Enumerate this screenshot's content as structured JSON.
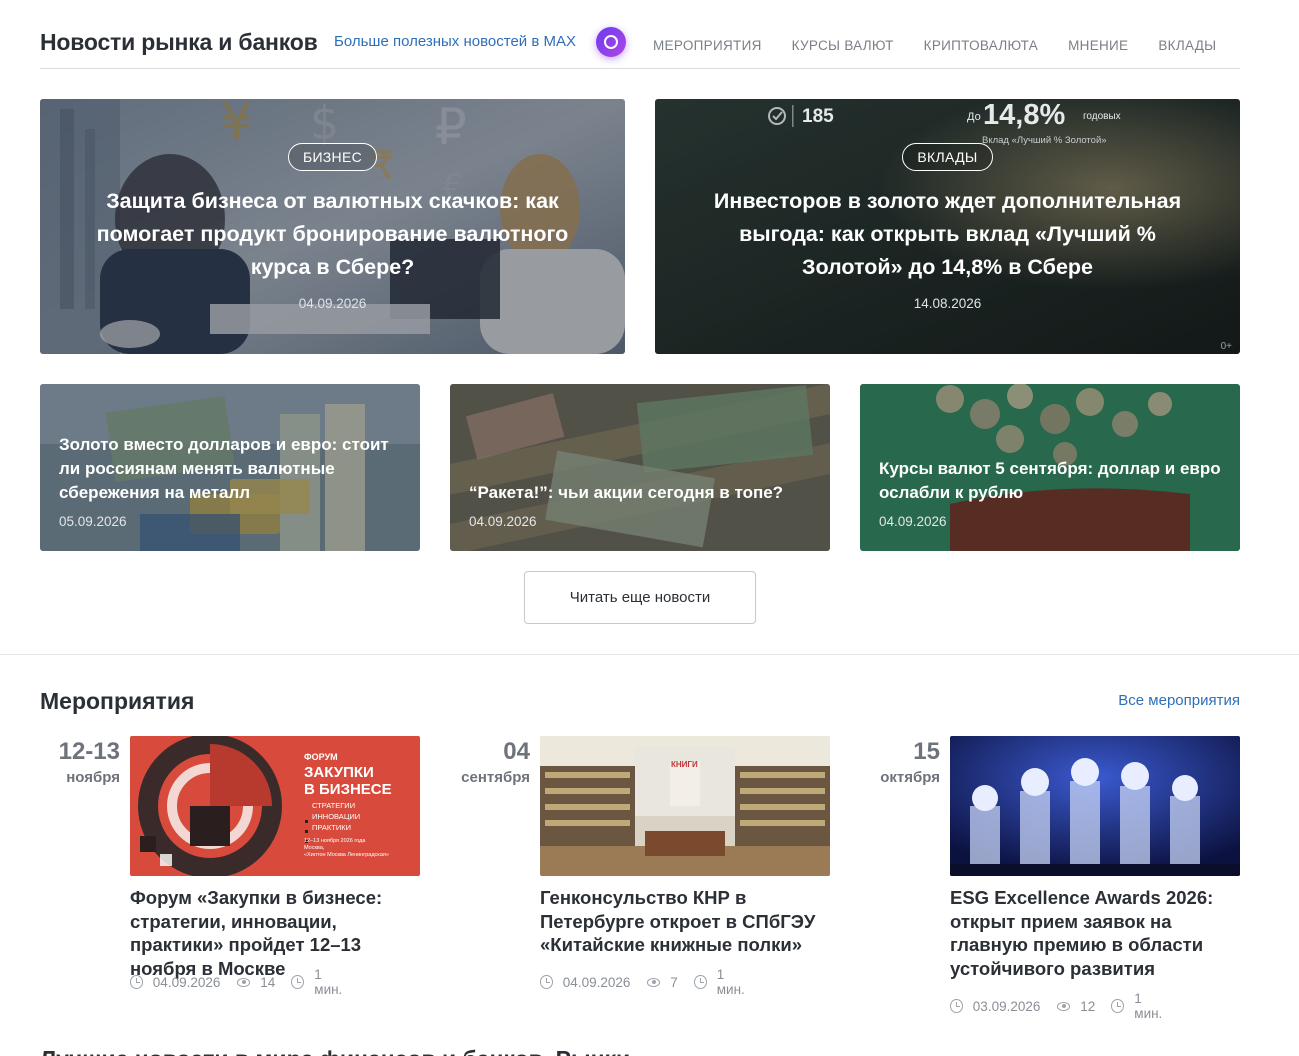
{
  "header": {
    "title": "Новости рынка и банков",
    "max_link": "Больше полезных новостей в MAX",
    "nav": [
      "МЕРОПРИЯТИЯ",
      "КУРСЫ ВАЛЮТ",
      "КРИПТОВАЛЮТА",
      "МНЕНИЕ",
      "ВКЛАДЫ"
    ]
  },
  "big_cards": [
    {
      "tag": "БИЗНЕС",
      "title": "Защита бизнеса от валютных скачков: как помогает продукт бронирование валютного курса в Сбере?",
      "date": "04.09.2026"
    },
    {
      "tag": "ВКЛАДЫ",
      "title": "Инвесторов в золото ждет дополнительная выгода: как открыть вклад «Лучший % Золотой» до 14,8% в Сбере",
      "date": "14.08.2026",
      "promo_number": "185",
      "promo_prefix": "До",
      "promo_rate": "14,8%",
      "promo_suffix": "годовых",
      "promo_caption": "Вклад «Лучший % Золотой»",
      "age": "0+"
    }
  ],
  "small_cards": [
    {
      "title": "Золото вместо долларов и евро: стоит ли россиянам менять валютные сбережения на металл",
      "date": "05.09.2026"
    },
    {
      "title": "“Ракета!”: чьи акции сегодня в топе?",
      "date": "04.09.2026"
    },
    {
      "title": "Курсы валют 5 сентября: доллар и евро ослабли к рублю",
      "date": "04.09.2026"
    }
  ],
  "read_more": "Читать еще новости",
  "events": {
    "title": "Мероприятия",
    "all_link": "Все мероприятия",
    "items": [
      {
        "day": "12-13",
        "month": "ноября",
        "title": "Форум «Закупки в бизнесе: стратегии, инновации, практики» пройдет 12–13 ноября в Москве",
        "date": "04.09.2026",
        "views": "14",
        "read_time": "1 мин.",
        "poster": {
          "label": "ФОРУМ",
          "heading1": "ЗАКУПКИ",
          "heading2": "В БИЗНЕСЕ",
          "items": [
            "СТРАТЕГИИ",
            "ИННОВАЦИИ",
            "ПРАКТИКИ"
          ],
          "footer1": "12–13 ноября 2026 года",
          "footer2": "Москва,",
          "footer3": "«Хилтон Москва Ленинградская»"
        }
      },
      {
        "day": "04",
        "month": "сентября",
        "title": "Генконсульство КНР в Петербурге откроет в СПбГЭУ «Китайские книжные полки»",
        "date": "04.09.2026",
        "views": "7",
        "read_time": "1 мин.",
        "poster": {
          "sign": "КНИГИ"
        }
      },
      {
        "day": "15",
        "month": "октября",
        "title": "ESG Excellence Awards 2026: открыт прием заявок на главную премию в области устойчивого развития",
        "date": "03.09.2026",
        "views": "12",
        "read_time": "1 мин."
      }
    ]
  },
  "next_section_title": "Лучшие новости в мире финансов и банков. Рынки"
}
